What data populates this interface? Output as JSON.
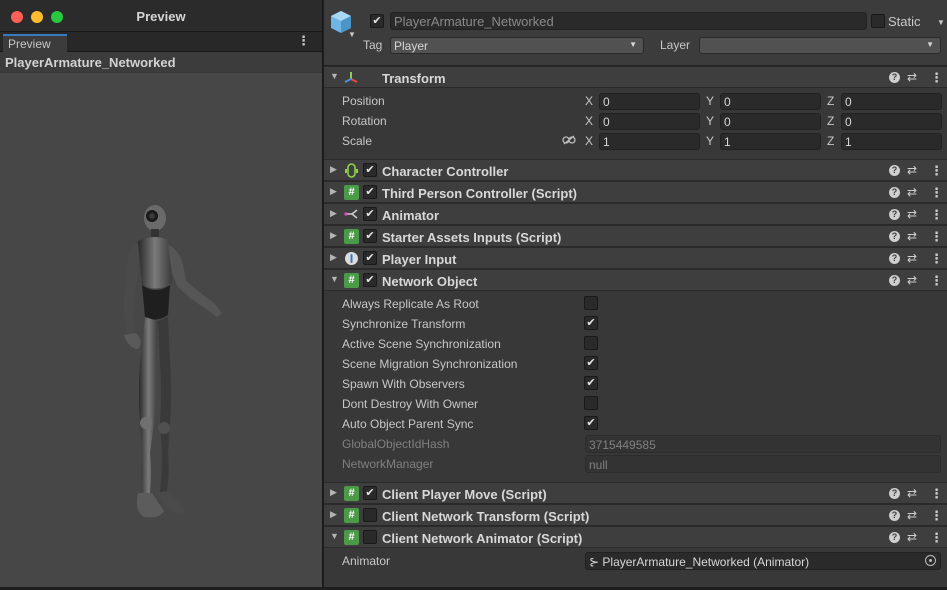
{
  "preview": {
    "window_title": "Preview",
    "tab_label": "Preview",
    "object_name": "PlayerArmature_Networked"
  },
  "inspector": {
    "gameobject_name": "PlayerArmature_Networked",
    "active": true,
    "static_label": "Static",
    "static": false,
    "tag_label": "Tag",
    "tag_value": "Player",
    "layer_label": "Layer",
    "layer_value": ""
  },
  "transform": {
    "title": "Transform",
    "position_label": "Position",
    "rotation_label": "Rotation",
    "scale_label": "Scale",
    "position": {
      "x": "0",
      "y": "0",
      "z": "0"
    },
    "rotation": {
      "x": "0",
      "y": "0",
      "z": "0"
    },
    "scale": {
      "x": "1",
      "y": "1",
      "z": "1"
    },
    "axis_x": "X",
    "axis_y": "Y",
    "axis_z": "Z"
  },
  "components": {
    "character_controller": {
      "title": "Character Controller",
      "enabled": true,
      "icon": "character-controller-icon"
    },
    "third_person_controller": {
      "title": "Third Person Controller (Script)",
      "enabled": true,
      "icon": "script-icon"
    },
    "animator": {
      "title": "Animator",
      "enabled": true,
      "icon": "animator-icon"
    },
    "starter_assets_inputs": {
      "title": "Starter Assets Inputs (Script)",
      "enabled": true,
      "icon": "script-icon"
    },
    "player_input": {
      "title": "Player Input",
      "enabled": true,
      "icon": "player-input-icon"
    },
    "network_object": {
      "title": "Network Object",
      "enabled": true,
      "icon": "script-icon"
    },
    "client_player_move": {
      "title": "Client Player Move (Script)",
      "enabled": true,
      "icon": "script-icon"
    },
    "client_network_transform": {
      "title": "Client Network Transform (Script)",
      "enabled": false,
      "icon": "script-icon"
    },
    "client_network_animator": {
      "title": "Client Network Animator (Script)",
      "enabled": false,
      "icon": "script-icon"
    }
  },
  "network_object_props": {
    "always_replicate_as_root": {
      "label": "Always Replicate As Root",
      "checked": false
    },
    "synchronize_transform": {
      "label": "Synchronize Transform",
      "checked": true
    },
    "active_scene_sync": {
      "label": "Active Scene Synchronization",
      "checked": false
    },
    "scene_migration_sync": {
      "label": "Scene Migration Synchronization",
      "checked": true
    },
    "spawn_with_observers": {
      "label": "Spawn With Observers",
      "checked": true
    },
    "dont_destroy_with_owner": {
      "label": "Dont Destroy With Owner",
      "checked": false
    },
    "auto_object_parent_sync": {
      "label": "Auto Object Parent Sync",
      "checked": true
    },
    "global_object_id_hash": {
      "label": "GlobalObjectIdHash",
      "value": "3715449585"
    },
    "network_manager": {
      "label": "NetworkManager",
      "value": "null"
    }
  },
  "client_network_animator_props": {
    "animator_label": "Animator",
    "animator_value": "PlayerArmature_Networked (Animator)"
  },
  "colors": {
    "script_icon": "#4b9a47",
    "tab_accent": "#3a79bb",
    "panel_bg": "#383838"
  }
}
